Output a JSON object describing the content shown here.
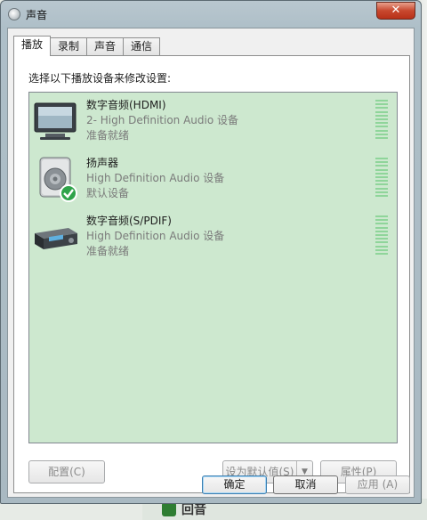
{
  "window": {
    "title": "声音",
    "close_label": "✕"
  },
  "tabs": [
    {
      "label": "播放",
      "active": true
    },
    {
      "label": "录制",
      "active": false
    },
    {
      "label": "声音",
      "active": false
    },
    {
      "label": "通信",
      "active": false
    }
  ],
  "panel": {
    "instruction": "选择以下播放设备来修改设置:"
  },
  "devices": [
    {
      "name": "数字音频(HDMI)",
      "description": "2- High Definition Audio 设备",
      "status": "准备就绪",
      "icon": "monitor-icon",
      "default": false
    },
    {
      "name": "扬声器",
      "description": "High Definition Audio 设备",
      "status": "默认设备",
      "icon": "speaker-icon",
      "default": true
    },
    {
      "name": "数字音频(S/PDIF)",
      "description": "High Definition Audio 设备",
      "status": "准备就绪",
      "icon": "receiver-icon",
      "default": false
    }
  ],
  "buttons": {
    "configure": "配置(C)",
    "set_default": "设为默认值(S)",
    "properties": "属性(P)",
    "ok": "确定",
    "cancel": "取消",
    "apply": "应用 (A)"
  },
  "background": {
    "bottom_text": "回音"
  },
  "colors": {
    "list_background": "#cde8cf",
    "meter": "#8fd59a",
    "close_button": "#c8482e",
    "default_check": "#2fa34a"
  }
}
